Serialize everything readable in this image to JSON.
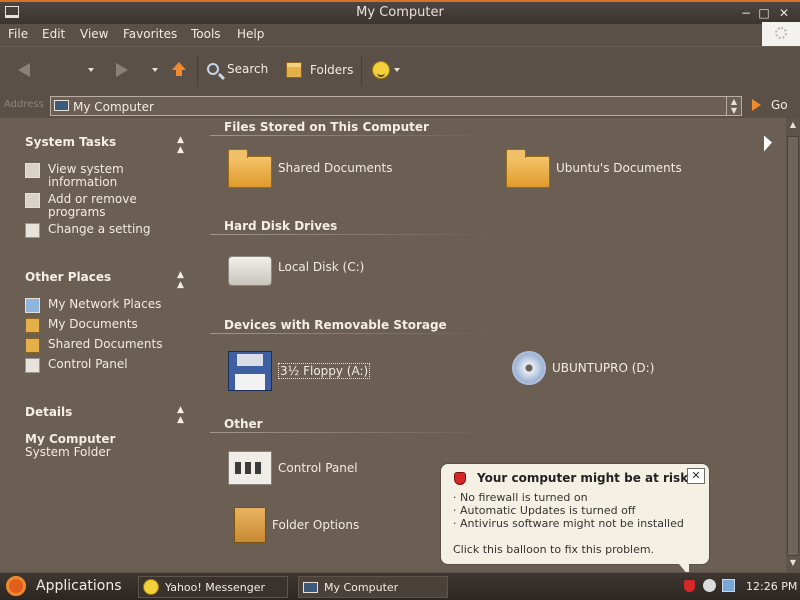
{
  "window": {
    "title": "My Computer",
    "minimize": "−",
    "maximize": "□",
    "close": "✕"
  },
  "menu": [
    "File",
    "Edit",
    "View",
    "Favorites",
    "Tools",
    "Help"
  ],
  "toolbar": {
    "search_label": "Search",
    "folders_label": "Folders"
  },
  "address": {
    "label": "Address",
    "value": "My Computer",
    "go_label": "Go"
  },
  "sidebar": {
    "system_tasks": {
      "title": "System Tasks",
      "items": [
        "View system information",
        "Add or remove programs",
        "Change a setting"
      ]
    },
    "other_places": {
      "title": "Other Places",
      "items": [
        "My Network Places",
        "My Documents",
        "Shared Documents",
        "Control Panel"
      ]
    },
    "details": {
      "title": "Details",
      "name": "My Computer",
      "type": "System Folder"
    }
  },
  "groups": {
    "files": {
      "title": "Files Stored on This Computer",
      "items": [
        "Shared Documents",
        "Ubuntu's Documents"
      ]
    },
    "hdd": {
      "title": "Hard Disk Drives",
      "items": [
        "Local Disk (C:)"
      ]
    },
    "removable": {
      "title": "Devices with Removable Storage",
      "items": [
        "3½ Floppy (A:)",
        "UBUNTUPRO (D:)"
      ]
    },
    "other": {
      "title": "Other",
      "items": [
        "Control Panel",
        "Folder Options"
      ]
    }
  },
  "balloon": {
    "title": "Your computer might be at risk",
    "close": "✕",
    "lines": [
      "· No firewall is turned on",
      "· Automatic Updates is turned off",
      "· Antivirus software might not be installed"
    ],
    "footer": "Click this balloon to fix this problem."
  },
  "taskbar": {
    "start_label": "Applications",
    "tasks": [
      "Yahoo! Messenger",
      "My Computer"
    ],
    "clock": "12:26 PM"
  },
  "colors": {
    "background": "#6b5e52",
    "accent": "#d3722a",
    "balloon": "#f4f1e4"
  }
}
